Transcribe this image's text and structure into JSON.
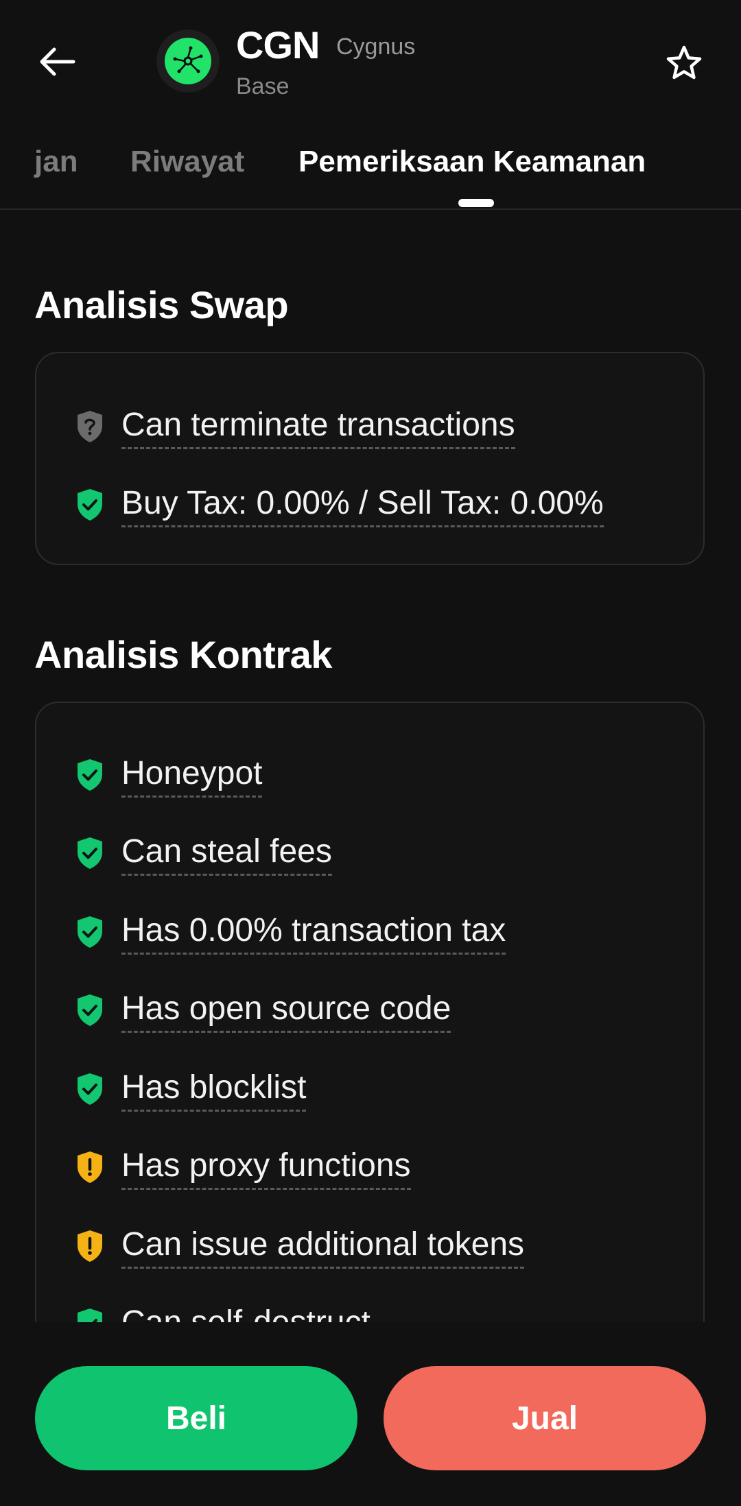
{
  "header": {
    "back_icon": "arrow-left-icon",
    "symbol": "CGN",
    "name": "Cygnus",
    "network": "Base",
    "favorite_icon": "star-icon",
    "logo_color": "#22e36a"
  },
  "tabs": [
    {
      "label": "jan",
      "active": false
    },
    {
      "label": "Riwayat",
      "active": false
    },
    {
      "label": "Pemeriksaan Keamanan",
      "active": true
    }
  ],
  "swap_analysis": {
    "title": "Analisis Swap",
    "items": [
      {
        "label": "Can terminate transactions",
        "status": "unknown",
        "icon": "shield-question-icon"
      },
      {
        "label": "Buy Tax: 0.00% / Sell Tax: 0.00%",
        "status": "safe",
        "icon": "shield-check-icon"
      }
    ]
  },
  "contract_analysis": {
    "title": "Analisis Kontrak",
    "items": [
      {
        "label": "Honeypot",
        "status": "safe",
        "icon": "shield-check-icon"
      },
      {
        "label": "Can steal fees",
        "status": "safe",
        "icon": "shield-check-icon"
      },
      {
        "label": "Has 0.00% transaction tax",
        "status": "safe",
        "icon": "shield-check-icon"
      },
      {
        "label": "Has open source code",
        "status": "safe",
        "icon": "shield-check-icon"
      },
      {
        "label": "Has blocklist",
        "status": "safe",
        "icon": "shield-check-icon"
      },
      {
        "label": "Has proxy functions",
        "status": "warning",
        "icon": "shield-warning-icon"
      },
      {
        "label": "Can issue additional tokens",
        "status": "warning",
        "icon": "shield-warning-icon"
      },
      {
        "label": "Can self-destruct",
        "status": "safe",
        "icon": "shield-check-icon"
      }
    ]
  },
  "actions": {
    "buy_label": "Beli",
    "sell_label": "Jual"
  },
  "colors": {
    "safe": "#12c76f",
    "warning": "#f5b214",
    "unknown": "#6b6b6b",
    "buy": "#10c46f",
    "sell": "#f26a5b"
  }
}
